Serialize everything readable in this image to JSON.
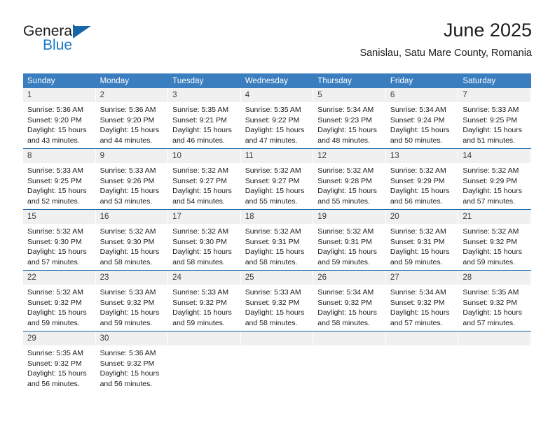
{
  "brand": {
    "name_top": "General",
    "name_bottom": "Blue",
    "accent_color": "#1878c8",
    "triangle_color": "#1565a8"
  },
  "header": {
    "title": "June 2025",
    "subtitle": "Sanislau, Satu Mare County, Romania"
  },
  "theme": {
    "header_row_bg": "#3a7ebf",
    "row_divider": "#1565a8",
    "daynum_bg": "#f0f0f0",
    "text": "#1b1b1b"
  },
  "calendar": {
    "weekday_headers": [
      "Sunday",
      "Monday",
      "Tuesday",
      "Wednesday",
      "Thursday",
      "Friday",
      "Saturday"
    ],
    "weeks": [
      [
        {
          "day": "1",
          "sunrise": "Sunrise: 5:36 AM",
          "sunset": "Sunset: 9:20 PM",
          "daylight1": "Daylight: 15 hours",
          "daylight2": "and 43 minutes."
        },
        {
          "day": "2",
          "sunrise": "Sunrise: 5:36 AM",
          "sunset": "Sunset: 9:20 PM",
          "daylight1": "Daylight: 15 hours",
          "daylight2": "and 44 minutes."
        },
        {
          "day": "3",
          "sunrise": "Sunrise: 5:35 AM",
          "sunset": "Sunset: 9:21 PM",
          "daylight1": "Daylight: 15 hours",
          "daylight2": "and 46 minutes."
        },
        {
          "day": "4",
          "sunrise": "Sunrise: 5:35 AM",
          "sunset": "Sunset: 9:22 PM",
          "daylight1": "Daylight: 15 hours",
          "daylight2": "and 47 minutes."
        },
        {
          "day": "5",
          "sunrise": "Sunrise: 5:34 AM",
          "sunset": "Sunset: 9:23 PM",
          "daylight1": "Daylight: 15 hours",
          "daylight2": "and 48 minutes."
        },
        {
          "day": "6",
          "sunrise": "Sunrise: 5:34 AM",
          "sunset": "Sunset: 9:24 PM",
          "daylight1": "Daylight: 15 hours",
          "daylight2": "and 50 minutes."
        },
        {
          "day": "7",
          "sunrise": "Sunrise: 5:33 AM",
          "sunset": "Sunset: 9:25 PM",
          "daylight1": "Daylight: 15 hours",
          "daylight2": "and 51 minutes."
        }
      ],
      [
        {
          "day": "8",
          "sunrise": "Sunrise: 5:33 AM",
          "sunset": "Sunset: 9:25 PM",
          "daylight1": "Daylight: 15 hours",
          "daylight2": "and 52 minutes."
        },
        {
          "day": "9",
          "sunrise": "Sunrise: 5:33 AM",
          "sunset": "Sunset: 9:26 PM",
          "daylight1": "Daylight: 15 hours",
          "daylight2": "and 53 minutes."
        },
        {
          "day": "10",
          "sunrise": "Sunrise: 5:32 AM",
          "sunset": "Sunset: 9:27 PM",
          "daylight1": "Daylight: 15 hours",
          "daylight2": "and 54 minutes."
        },
        {
          "day": "11",
          "sunrise": "Sunrise: 5:32 AM",
          "sunset": "Sunset: 9:27 PM",
          "daylight1": "Daylight: 15 hours",
          "daylight2": "and 55 minutes."
        },
        {
          "day": "12",
          "sunrise": "Sunrise: 5:32 AM",
          "sunset": "Sunset: 9:28 PM",
          "daylight1": "Daylight: 15 hours",
          "daylight2": "and 55 minutes."
        },
        {
          "day": "13",
          "sunrise": "Sunrise: 5:32 AM",
          "sunset": "Sunset: 9:29 PM",
          "daylight1": "Daylight: 15 hours",
          "daylight2": "and 56 minutes."
        },
        {
          "day": "14",
          "sunrise": "Sunrise: 5:32 AM",
          "sunset": "Sunset: 9:29 PM",
          "daylight1": "Daylight: 15 hours",
          "daylight2": "and 57 minutes."
        }
      ],
      [
        {
          "day": "15",
          "sunrise": "Sunrise: 5:32 AM",
          "sunset": "Sunset: 9:30 PM",
          "daylight1": "Daylight: 15 hours",
          "daylight2": "and 57 minutes."
        },
        {
          "day": "16",
          "sunrise": "Sunrise: 5:32 AM",
          "sunset": "Sunset: 9:30 PM",
          "daylight1": "Daylight: 15 hours",
          "daylight2": "and 58 minutes."
        },
        {
          "day": "17",
          "sunrise": "Sunrise: 5:32 AM",
          "sunset": "Sunset: 9:30 PM",
          "daylight1": "Daylight: 15 hours",
          "daylight2": "and 58 minutes."
        },
        {
          "day": "18",
          "sunrise": "Sunrise: 5:32 AM",
          "sunset": "Sunset: 9:31 PM",
          "daylight1": "Daylight: 15 hours",
          "daylight2": "and 58 minutes."
        },
        {
          "day": "19",
          "sunrise": "Sunrise: 5:32 AM",
          "sunset": "Sunset: 9:31 PM",
          "daylight1": "Daylight: 15 hours",
          "daylight2": "and 59 minutes."
        },
        {
          "day": "20",
          "sunrise": "Sunrise: 5:32 AM",
          "sunset": "Sunset: 9:31 PM",
          "daylight1": "Daylight: 15 hours",
          "daylight2": "and 59 minutes."
        },
        {
          "day": "21",
          "sunrise": "Sunrise: 5:32 AM",
          "sunset": "Sunset: 9:32 PM",
          "daylight1": "Daylight: 15 hours",
          "daylight2": "and 59 minutes."
        }
      ],
      [
        {
          "day": "22",
          "sunrise": "Sunrise: 5:32 AM",
          "sunset": "Sunset: 9:32 PM",
          "daylight1": "Daylight: 15 hours",
          "daylight2": "and 59 minutes."
        },
        {
          "day": "23",
          "sunrise": "Sunrise: 5:33 AM",
          "sunset": "Sunset: 9:32 PM",
          "daylight1": "Daylight: 15 hours",
          "daylight2": "and 59 minutes."
        },
        {
          "day": "24",
          "sunrise": "Sunrise: 5:33 AM",
          "sunset": "Sunset: 9:32 PM",
          "daylight1": "Daylight: 15 hours",
          "daylight2": "and 59 minutes."
        },
        {
          "day": "25",
          "sunrise": "Sunrise: 5:33 AM",
          "sunset": "Sunset: 9:32 PM",
          "daylight1": "Daylight: 15 hours",
          "daylight2": "and 58 minutes."
        },
        {
          "day": "26",
          "sunrise": "Sunrise: 5:34 AM",
          "sunset": "Sunset: 9:32 PM",
          "daylight1": "Daylight: 15 hours",
          "daylight2": "and 58 minutes."
        },
        {
          "day": "27",
          "sunrise": "Sunrise: 5:34 AM",
          "sunset": "Sunset: 9:32 PM",
          "daylight1": "Daylight: 15 hours",
          "daylight2": "and 57 minutes."
        },
        {
          "day": "28",
          "sunrise": "Sunrise: 5:35 AM",
          "sunset": "Sunset: 9:32 PM",
          "daylight1": "Daylight: 15 hours",
          "daylight2": "and 57 minutes."
        }
      ],
      [
        {
          "day": "29",
          "sunrise": "Sunrise: 5:35 AM",
          "sunset": "Sunset: 9:32 PM",
          "daylight1": "Daylight: 15 hours",
          "daylight2": "and 56 minutes."
        },
        {
          "day": "30",
          "sunrise": "Sunrise: 5:36 AM",
          "sunset": "Sunset: 9:32 PM",
          "daylight1": "Daylight: 15 hours",
          "daylight2": "and 56 minutes."
        },
        {
          "day": "",
          "sunrise": "",
          "sunset": "",
          "daylight1": "",
          "daylight2": ""
        },
        {
          "day": "",
          "sunrise": "",
          "sunset": "",
          "daylight1": "",
          "daylight2": ""
        },
        {
          "day": "",
          "sunrise": "",
          "sunset": "",
          "daylight1": "",
          "daylight2": ""
        },
        {
          "day": "",
          "sunrise": "",
          "sunset": "",
          "daylight1": "",
          "daylight2": ""
        },
        {
          "day": "",
          "sunrise": "",
          "sunset": "",
          "daylight1": "",
          "daylight2": ""
        }
      ]
    ]
  }
}
